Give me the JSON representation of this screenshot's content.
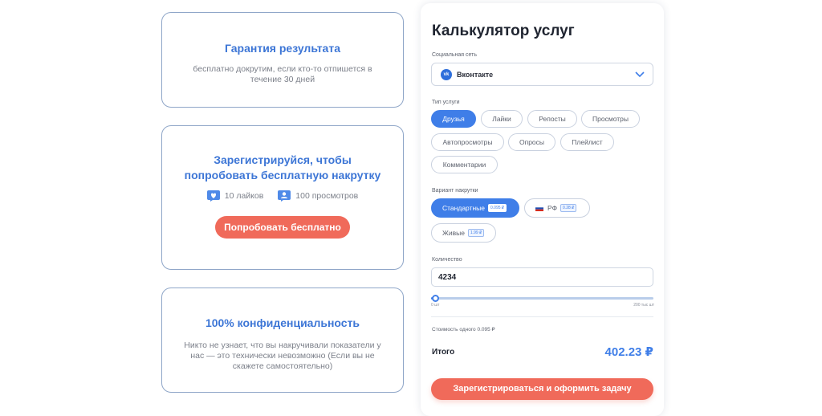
{
  "cards": {
    "guarantee": {
      "title": "Гарантия результата",
      "text": "бесплатно докрутим, если кто-то отпишется в течение 30 дней"
    },
    "trial": {
      "title": "Зарегистрируйся, чтобы попробовать бесплатную накрутку",
      "perk_likes": "10 лайков",
      "perk_views": "100 просмотров",
      "button": "Попробовать бесплатно"
    },
    "privacy": {
      "title": "100% конфиденциальность",
      "text": "Никто не узнает, что вы накручивали показатели у нас — это технически невозможно (Если вы не скажете самостоятельно)"
    }
  },
  "calculator": {
    "title": "Калькулятор услуг",
    "network_label": "Социальная сеть",
    "network_value": "Вконтакте",
    "network_icon": "vk",
    "service_label": "Тип услуги",
    "services": [
      "Друзья",
      "Лайки",
      "Репосты",
      "Просмотры",
      "Автопросмотры",
      "Опросы",
      "Плейлист",
      "Комментарии"
    ],
    "active_service": "Друзья",
    "variant_label": "Вариант накрутки",
    "variants": [
      {
        "label": "Стандартные",
        "price": "0.095 ₽",
        "active": true
      },
      {
        "label": "РФ",
        "price": "0.28 ₽",
        "active": false
      },
      {
        "label": "Живые",
        "price": "1.99 ₽",
        "active": false
      }
    ],
    "quantity_label": "Количество",
    "quantity_value": "4234",
    "slider_min": "0 шт",
    "slider_max": "200 тыс шт",
    "slider_fraction": 0.021,
    "unit_cost": "Стоимость одного 0.095 ₽",
    "total_label": "Итого",
    "total_value": "402.23 ₽",
    "submit": "Зарегистрироваться и оформить задачу"
  },
  "colors": {
    "accent_blue": "#3f7ee8",
    "accent_coral": "#f06a5a",
    "card_border": "#8fa6c8"
  }
}
